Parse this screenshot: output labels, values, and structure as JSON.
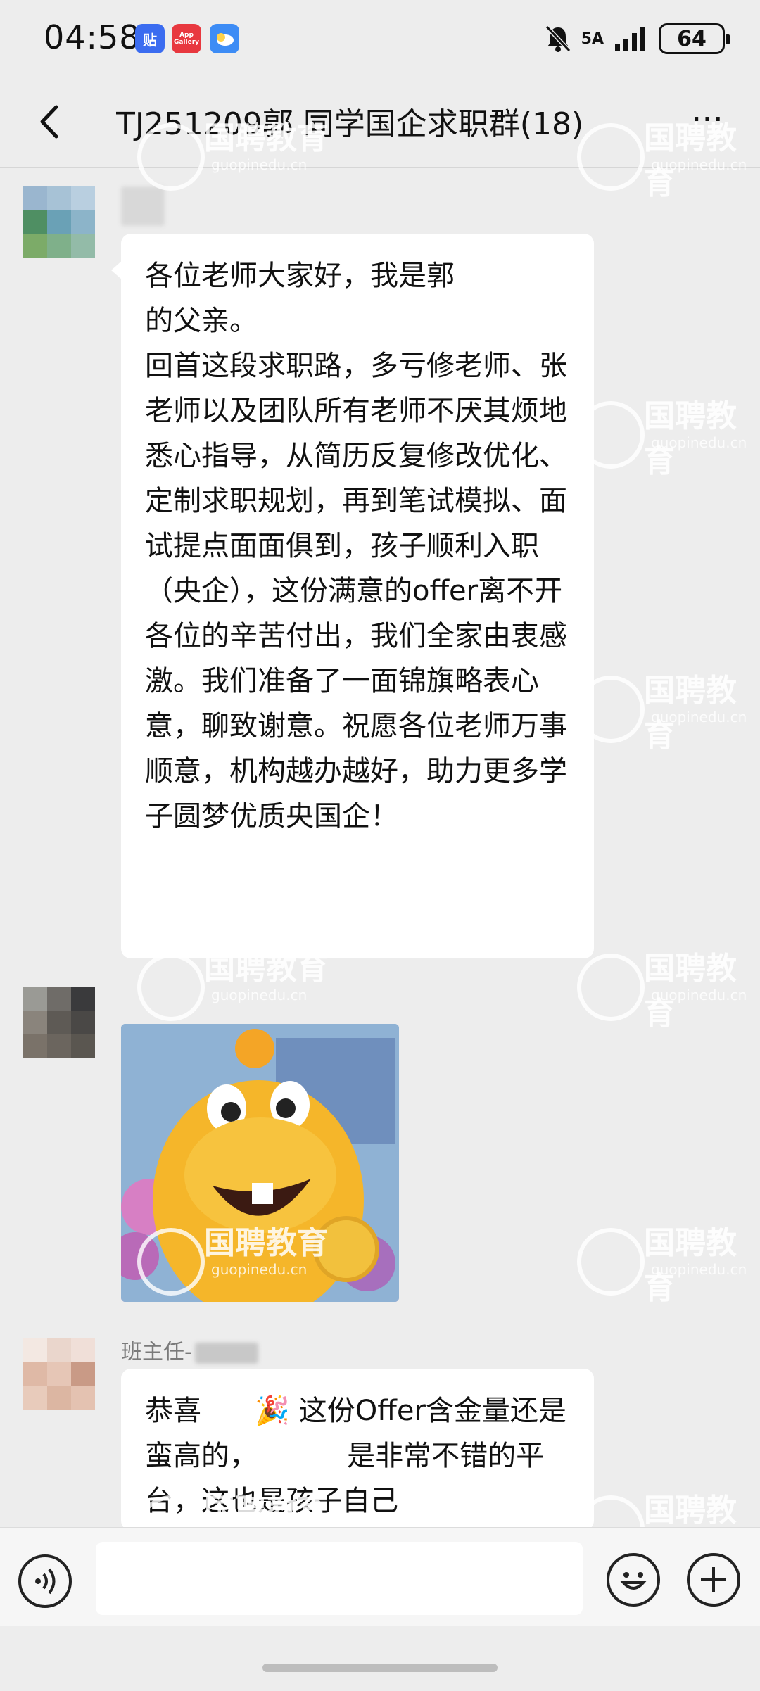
{
  "status_bar": {
    "time": "04:58",
    "notif_icons": [
      "tieba-icon",
      "app-gallery-icon",
      "weather-icon"
    ],
    "notif_icon_labels": [
      "贴",
      "App Gallery",
      ""
    ],
    "network": "5A",
    "battery": "64"
  },
  "header": {
    "title": "TJ251209郭   同学国企求职群(18)",
    "more_label": "···"
  },
  "messages": [
    {
      "sender": "",
      "text": "各位老师大家好，我是郭\n的父亲。\n回首这段求职路，多亏修老师、张老师以及团队所有老师不厌其烦地悉心指导，从简历反复修改优化、定制求职规划，再到笔试模拟、面试提点面面俱到，孩子顺利入职\n（央企），这份满意的offer离不开各位的辛苦付出，我们全家由衷感激。我们准备了一面锦旗略表心意，聊致谢意。祝愿各位老师万事顺意，机构越办越好，助力更多学子圆梦优质央国企！"
    },
    {
      "sender": "",
      "type": "sticker"
    },
    {
      "sender": "班主任-",
      "text": "恭喜      🎉 这份Offer含金量还是蛮高的，          是非常不错的平台，这也是孩子自己"
    }
  ],
  "watermark": {
    "brand": "国聘教育",
    "url": "guopinedu.cn"
  },
  "colors": {
    "background": "#ededed",
    "bubble": "#ffffff",
    "text": "#111111"
  }
}
